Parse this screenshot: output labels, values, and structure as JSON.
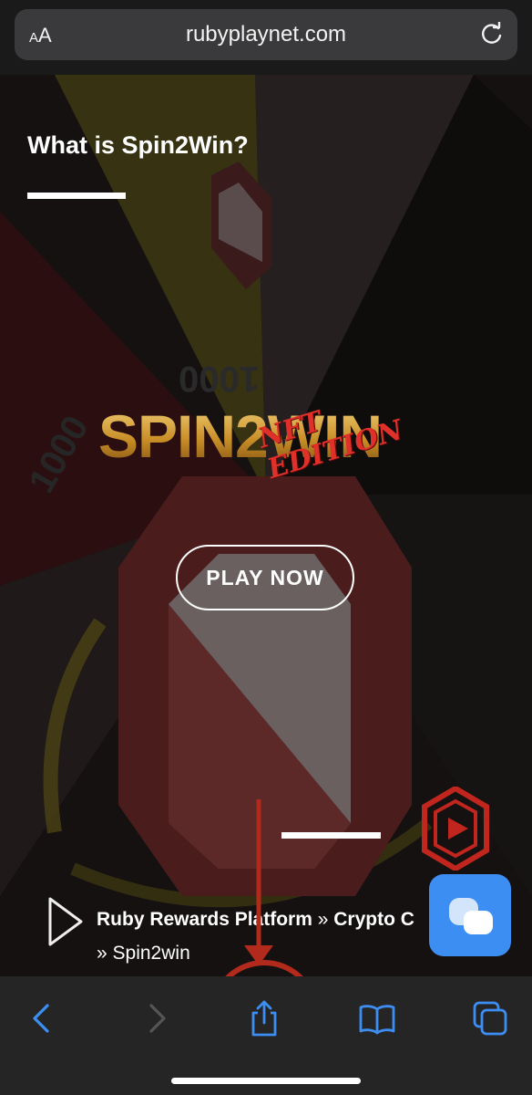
{
  "browser": {
    "text_size_label_small": "A",
    "text_size_label_large": "A",
    "url": "rubyplaynet.com"
  },
  "page": {
    "heading": "What is Spin2Win?",
    "logo_main": "SPIN2WIN",
    "logo_sub": "NFT EDITION",
    "play_button": "PLAY NOW",
    "breadcrumb": {
      "item1": "Ruby Rewards Platform",
      "separator": "»",
      "item2": "Crypto C",
      "item3": "Spin2win"
    }
  },
  "wheel_labels": {
    "a": "1000",
    "b": "1000"
  },
  "icons": {
    "reload": "reload-icon",
    "back": "back-chevron-icon",
    "forward": "forward-chevron-icon",
    "share": "share-icon",
    "bookmarks": "book-icon",
    "tabs": "tabs-icon",
    "chat": "chat-bubbles-icon",
    "play": "play-triangle-icon"
  },
  "colors": {
    "accent_blue": "#3d8ef2",
    "annotation_red": "#b12a1c",
    "ruby_red": "#c0261d",
    "gold": "#c9942a"
  }
}
